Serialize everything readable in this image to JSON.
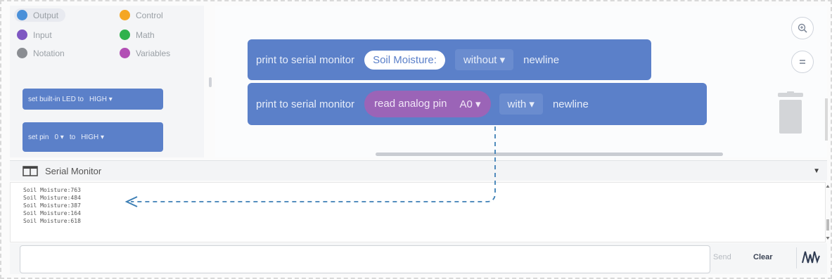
{
  "toolbox": {
    "categories": [
      {
        "label": "Output",
        "color": "#4a90d9"
      },
      {
        "label": "Control",
        "color": "#f5a623"
      },
      {
        "label": "Input",
        "color": "#7e57c2"
      },
      {
        "label": "Math",
        "color": "#2fb24c"
      },
      {
        "label": "Notation",
        "color": "#8a8d92"
      },
      {
        "label": "Variables",
        "color": "#b24fb5"
      }
    ],
    "blocks": {
      "set_led": {
        "label": "set built-in LED to",
        "value": "HIGH"
      },
      "set_pin": {
        "label": "set pin",
        "pin": "0",
        "to_label": "to",
        "value": "HIGH"
      }
    }
  },
  "workspace": {
    "block1": {
      "label": "print to serial monitor",
      "text": "Soil Moisture:",
      "mode": "without",
      "suffix": "newline"
    },
    "block2": {
      "label": "print to serial monitor",
      "inner_label": "read analog pin",
      "pin": "A0",
      "mode": "with",
      "suffix": "newline"
    },
    "colors": {
      "block": "#5b80c9",
      "analog": "#9b64b7",
      "arrow": "#3d7fb5"
    }
  },
  "serial": {
    "title": "Serial Monitor",
    "lines": [
      "Soil Moisture:763",
      "Soil Moisture:484",
      "Soil Moisture:387",
      "Soil Moisture:164",
      "Soil Moisture:618"
    ],
    "send_label": "Send",
    "clear_label": "Clear",
    "input_value": ""
  }
}
